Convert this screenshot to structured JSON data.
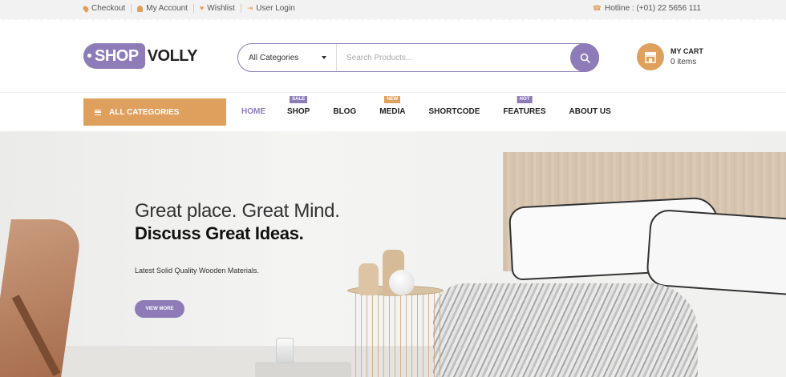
{
  "topbar": {
    "links": [
      {
        "label": "Checkout",
        "icon": "location-pin-icon"
      },
      {
        "label": "My Account",
        "icon": "user-icon"
      },
      {
        "label": "Wishlist",
        "icon": "heart-icon"
      },
      {
        "label": "User Login",
        "icon": "login-icon"
      }
    ],
    "hotline": "Hotline : (+01) 22 5656 111"
  },
  "header": {
    "logo_tag": "SHOP",
    "logo_rest": "VOLLY",
    "search": {
      "category": "All Categories",
      "placeholder": "Search Products..."
    },
    "cart": {
      "title": "MY CART",
      "count": "0 items"
    }
  },
  "nav": {
    "all_categories": "ALL CATEGORIES",
    "items": [
      {
        "label": "HOME",
        "badge": ""
      },
      {
        "label": "SHOP",
        "badge": "SALE"
      },
      {
        "label": "BLOG",
        "badge": ""
      },
      {
        "label": "MEDIA",
        "badge": "NEW"
      },
      {
        "label": "SHORTCODE",
        "badge": ""
      },
      {
        "label": "FEATURES",
        "badge": "HOT"
      },
      {
        "label": "ABOUT US",
        "badge": ""
      }
    ]
  },
  "hero": {
    "headline_light": "Great place. Great Mind.",
    "headline_bold": "Discuss Great Ideas.",
    "subtext": "Latest Solid Quality Wooden Materials.",
    "button": "VIEW MORE"
  },
  "colors": {
    "accent_purple": "#8d7cb7",
    "accent_orange": "#e0a05d"
  }
}
